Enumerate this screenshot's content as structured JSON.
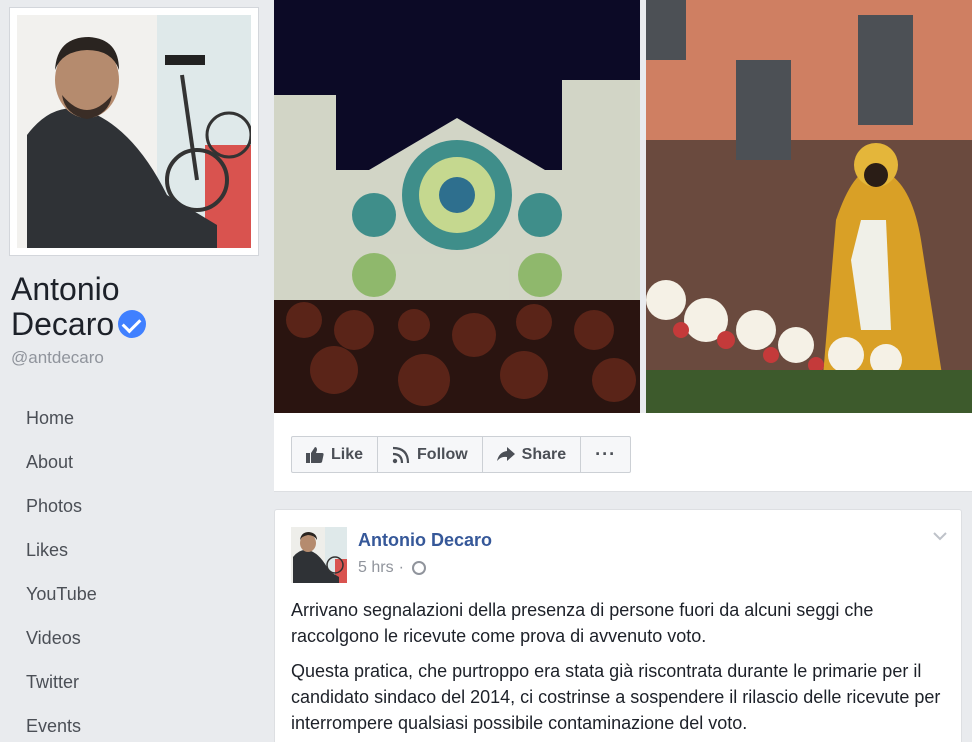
{
  "page": {
    "name_line1": "Antonio",
    "name_line2": "Decaro",
    "handle": "@antdecaro"
  },
  "nav": [
    {
      "label": "Home"
    },
    {
      "label": "About"
    },
    {
      "label": "Photos"
    },
    {
      "label": "Likes"
    },
    {
      "label": "YouTube"
    },
    {
      "label": "Videos"
    },
    {
      "label": "Twitter"
    },
    {
      "label": "Events"
    }
  ],
  "actions": {
    "like": "Like",
    "follow": "Follow",
    "share": "Share",
    "more": "···"
  },
  "post": {
    "author": "Antonio Decaro",
    "time": "5 hrs",
    "separator": "·",
    "paragraph1": "Arrivano segnalazioni della presenza di persone fuori da alcuni seggi che raccolgono le ricevute come prova di avvenuto voto.",
    "paragraph2": "Questa pratica, che purtroppo era stata già riscontrata durante le primarie per il candidato sindaco del 2014, ci costrinse a sospendere il rilascio delle ricevute per interrompere qualsiasi possibile contaminazione del voto."
  },
  "colors": {
    "link": "#365899",
    "verified": "#4080ff",
    "background": "#e9ebee"
  },
  "icons": [
    "verified-badge-icon",
    "like-thumb-icon",
    "follow-rss-icon",
    "share-arrow-icon",
    "more-dots-icon",
    "globe-icon",
    "chevron-down-icon"
  ]
}
